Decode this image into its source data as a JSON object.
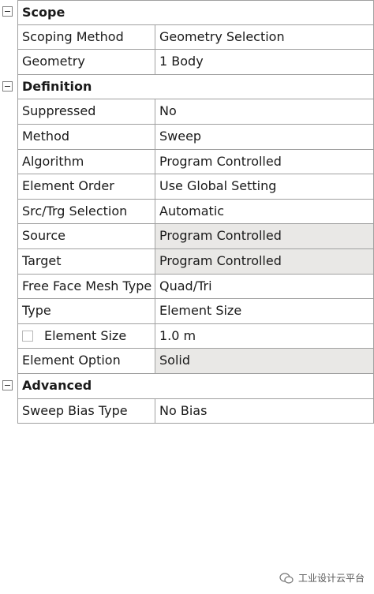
{
  "groups": {
    "scope": {
      "label": "Scope",
      "rows": [
        {
          "name": "Scoping Method",
          "value": "Geometry Selection"
        },
        {
          "name": "Geometry",
          "value": "1 Body"
        }
      ]
    },
    "definition": {
      "label": "Definition",
      "rows": [
        {
          "name": "Suppressed",
          "value": "No"
        },
        {
          "name": "Method",
          "value": "Sweep"
        },
        {
          "name": "Algorithm",
          "value": "Program Controlled"
        },
        {
          "name": "Element Order",
          "value": "Use Global Setting"
        },
        {
          "name": "Src/Trg Selection",
          "value": "Automatic"
        },
        {
          "name": "Source",
          "value": "Program Controlled"
        },
        {
          "name": "Target",
          "value": "Program Controlled"
        },
        {
          "name": "Free Face Mesh Type",
          "value": "Quad/Tri"
        },
        {
          "name": "Type",
          "value": "Element Size"
        },
        {
          "name": "Element Size",
          "value": "1.0 m"
        },
        {
          "name": "Element Option",
          "value": "Solid"
        }
      ]
    },
    "advanced": {
      "label": "Advanced",
      "rows": [
        {
          "name": "Sweep Bias Type",
          "value": "No Bias"
        }
      ]
    }
  },
  "watermark": {
    "text": "工业设计云平台"
  },
  "colors": {
    "shaded_value_bg": "#e9e8e6",
    "grid_line": "#a0a0a0"
  }
}
